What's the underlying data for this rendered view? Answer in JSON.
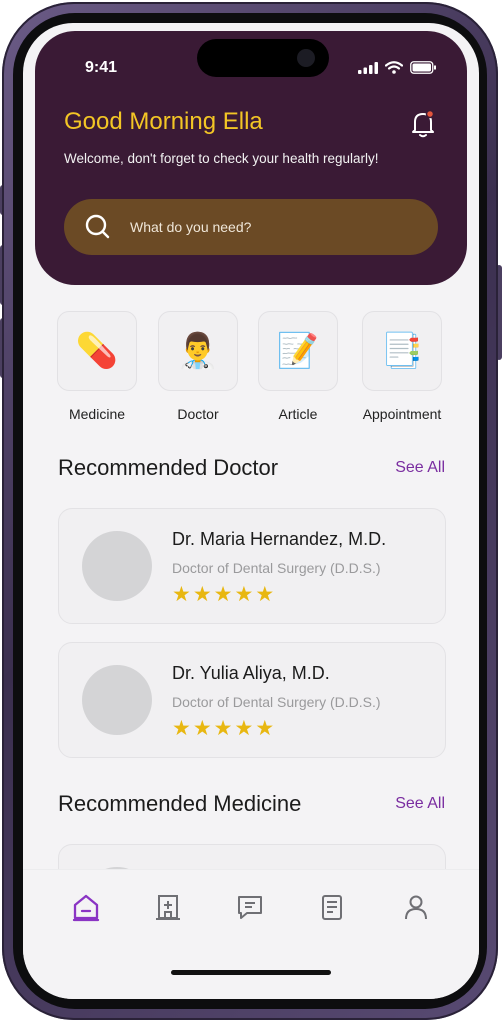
{
  "status": {
    "time": "9:41"
  },
  "header": {
    "greeting": "Good Morning Ella",
    "subtitle": "Welcome, don't forget to check your health regularly!",
    "search_placeholder": "What do you need?"
  },
  "categories": [
    {
      "label": "Medicine",
      "icon": "pill-icon",
      "glyph": "💊"
    },
    {
      "label": "Doctor",
      "icon": "doctor-icon",
      "glyph": "👨‍⚕️"
    },
    {
      "label": "Article",
      "icon": "article-icon",
      "glyph": "📝"
    },
    {
      "label": "Appointment",
      "icon": "appointment-icon",
      "glyph": "📑"
    }
  ],
  "recommended_doctor": {
    "title": "Recommended Doctor",
    "see_all": "See All",
    "doctors": [
      {
        "name": "Dr. Maria Hernandez, M.D.",
        "specialty": "Doctor of Dental Surgery (D.D.S.)",
        "rating": 5
      },
      {
        "name": "Dr. Yulia Aliya, M.D.",
        "specialty": "Doctor of Dental Surgery (D.D.S.)",
        "rating": 5
      }
    ]
  },
  "recommended_medicine": {
    "title": "Recommended Medicine",
    "see_all": "See All"
  },
  "colors": {
    "header_bg": "#3a1a35",
    "accent_yellow": "#f3c625",
    "search_bg": "#6b4a25",
    "link_purple": "#7a2da0",
    "star": "#e8b711"
  },
  "nav": [
    "home-icon",
    "hospital-icon",
    "chat-icon",
    "document-icon",
    "profile-icon"
  ]
}
